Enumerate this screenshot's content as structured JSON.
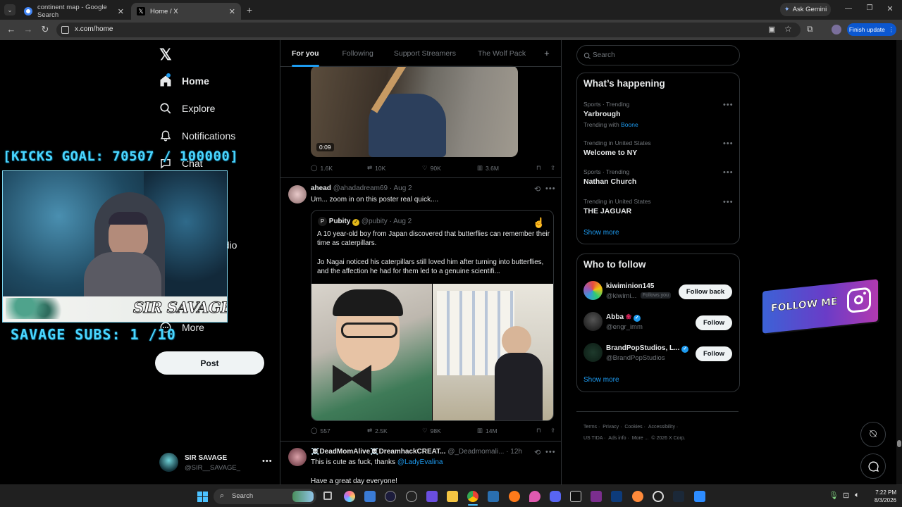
{
  "browser": {
    "tabs": [
      {
        "title": "continent map - Google Search",
        "active": false
      },
      {
        "title": "Home / X",
        "active": true
      }
    ],
    "ask_gemini": "Ask Gemini",
    "url": "x.com/home",
    "finish_update": "Finish update"
  },
  "sidebar": {
    "nav": [
      {
        "label": "Home",
        "icon": "home-icon"
      },
      {
        "label": "Explore",
        "icon": "search-icon"
      },
      {
        "label": "Notifications",
        "icon": "bell-icon"
      },
      {
        "label": "Chat",
        "icon": "chat-icon"
      },
      {
        "label": "udio",
        "icon": "creator-studio-icon"
      },
      {
        "label": "More",
        "icon": "more-circle-icon"
      }
    ],
    "post_label": "Post",
    "account": {
      "name": "SIR SAVAGE",
      "handle": "@SIR__SAVAGE_"
    }
  },
  "overlay": {
    "kicks_goal": "[KICKS GOAL: 70507 / 100000]",
    "subs": "SAVAGE SUBS: 1 /10",
    "webcam_brand": "SIR SAVAGE",
    "follow_me": "FOLLOW ME"
  },
  "feed": {
    "tabs": [
      "For you",
      "Following",
      "Support Streamers",
      "The Wolf Pack"
    ],
    "add_tab_icon": "+",
    "post1": {
      "video_time": "0:09",
      "replies": "1.6K",
      "reposts": "10K",
      "likes": "90K",
      "views": "3.6M"
    },
    "post2": {
      "name": "ahead",
      "handle": "@ahadadream69",
      "date": "· Aug 2",
      "text": "Um... zoom in on this poster real quick....",
      "quote": {
        "name": "Pubity",
        "handle": "@pubity",
        "date": "· Aug 2",
        "text1": "A 10 year-old boy from Japan discovered that butterflies can remember their time as caterpillars.",
        "text2": "Jo Nagai noticed his caterpillars still loved him after turning into butterflies, and the affection he had for them led to a genuine scientifi..."
      },
      "replies": "557",
      "reposts": "2.5K",
      "likes": "98K",
      "views": "14M"
    },
    "post3": {
      "name": "☠️DeadMomAlive☠️DreamhackCREAT...",
      "handle": "@_Deadmomali...",
      "date": "· 12h",
      "text_prefix": "This is cute as fuck, thanks ",
      "mention": "@LadyEvalina",
      "text2": "Have a great day everyone!"
    }
  },
  "right": {
    "search_placeholder": "Search",
    "whats_happening": {
      "title": "What’s happening",
      "trends": [
        {
          "meta": "Sports · Trending",
          "name": "Yarbrough",
          "extra_prefix": "Trending with",
          "extra_link": "Boone"
        },
        {
          "meta": "Trending in United States",
          "name": "Welcome to NY"
        },
        {
          "meta": "Sports · Trending",
          "name": "Nathan Church"
        },
        {
          "meta": "Trending in United States",
          "name": "THE JAGUAR"
        }
      ],
      "show_more": "Show more"
    },
    "who_to_follow": {
      "title": "Who to follow",
      "accounts": [
        {
          "name": "kiwiminion145",
          "handle": "@kiwimi...",
          "badge": "Follows you",
          "button": "Follow back"
        },
        {
          "name": "Abba",
          "handle": "@engr_imm",
          "button": "Follow"
        },
        {
          "name": "BrandPopStudios, L...",
          "handle": "@BrandPopStudios",
          "button": "Follow"
        }
      ],
      "show_more": "Show more"
    },
    "footer": [
      "Terms",
      "Privacy",
      "Cookies",
      "Accessibility",
      "US TIDA",
      "Ads info",
      "More ...",
      "© 2026 X Corp."
    ]
  },
  "taskbar": {
    "search": "Search",
    "time": "7:22 PM",
    "date": "8/3/2026"
  },
  "colors": {
    "accent": "#1d9bf0",
    "overlay_cyan": "#4ad6ff",
    "chrome_blue": "#0b57d0"
  }
}
